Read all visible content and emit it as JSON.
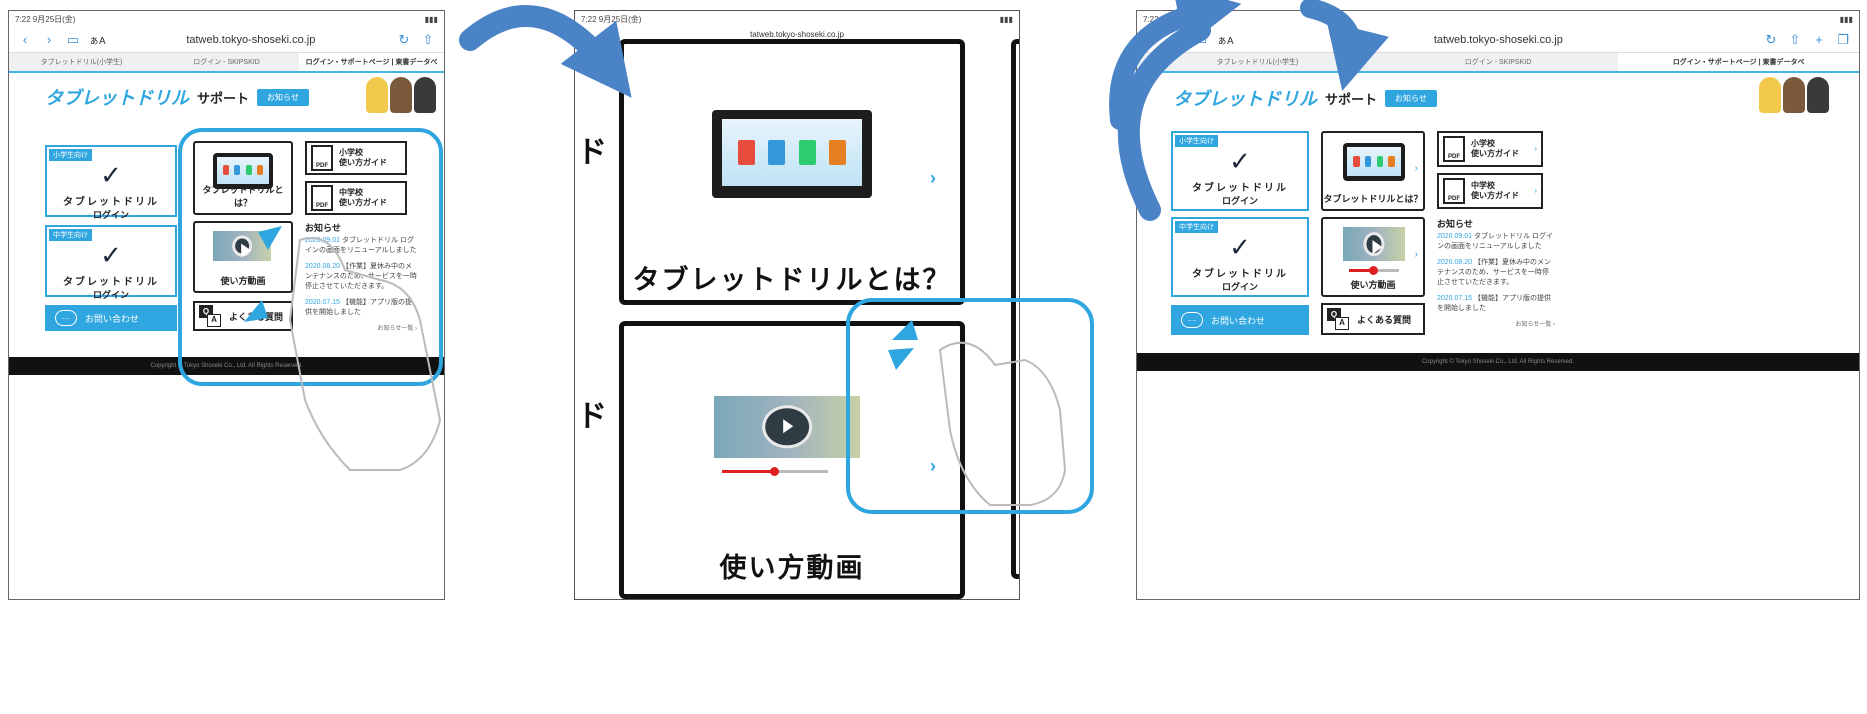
{
  "browser": {
    "status_time": "7:22 9月25日(金)",
    "url": "tatweb.tokyo-shoseki.co.jp",
    "url_zoomed": "tatweb.tokyo-shoseki.co.jp",
    "text_size_button": "ぁA",
    "tabs": [
      "タブレットドリル(小学生)",
      "ログイン - SKIPSKID",
      "ログイン・サポートページ | 東書データベ"
    ]
  },
  "site": {
    "logo": "タブレットドリル",
    "support": "サポート",
    "header_button": "お知らせ",
    "tag_elementary": "小学生向け",
    "tag_junior": "中学生向け",
    "login_title": "タブレットドリル",
    "login_sub": "ログイン",
    "contact": "お問い合わせ",
    "tile_about": "タブレットドリルとは？",
    "tile_video": "使い方動画",
    "faq": "よくある質問",
    "guide_elementary": [
      "小学校",
      "使い方ガイド"
    ],
    "guide_junior": [
      "中学校",
      "使い方ガイド"
    ],
    "pdf_label": "PDF",
    "news_title": "お知らせ",
    "news": [
      {
        "date": "2020.09.01",
        "text": "タブレットドリル ログインの画面をリニューアルしました"
      },
      {
        "date": "2020.08.20",
        "text": "【作業】夏休み中のメンテナンスのため、サービスを一時停止させていただきます。"
      },
      {
        "date": "2020.07.15",
        "text": "【機能】アプリ版の提供を開始しました"
      }
    ],
    "news_more": "お知らせ一覧 ›",
    "copyright": "Copyright © Tokyo Shoseki Co., Ltd. All Rights Reserved."
  },
  "zoom": {
    "title_about": "タブレットドリルとは？",
    "title_video": "使い方動画",
    "edge_char": "ド"
  },
  "colors": {
    "accent": "#2fa6e0",
    "arrow": "#4a84c6",
    "highlight": "#2fa6e0"
  },
  "icons": [
    "curved-arrow-icon",
    "pinch-in-gesture-icon",
    "pinch-out-gesture-icon",
    "play-icon",
    "pdf-icon",
    "chat-bubble-icon",
    "qa-icon",
    "chevron-right-icon"
  ]
}
